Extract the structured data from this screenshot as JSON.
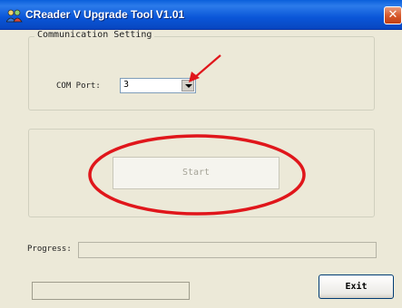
{
  "window": {
    "title": "CReader V Upgrade Tool V1.01",
    "close_label": "✕",
    "icon": "people-app-icon"
  },
  "communication": {
    "legend": "Communication  Setting",
    "com_port_label": "COM Port:",
    "com_port_value": "3"
  },
  "actions": {
    "start_label": "Start",
    "start_enabled": false
  },
  "progress": {
    "label": "Progress:",
    "value": 0
  },
  "footer": {
    "exit_label": "Exit"
  },
  "annotations": {
    "color": "#E0161B",
    "shapes": [
      "arrow pointing to COM port dropdown",
      "ellipse around Start button"
    ]
  }
}
